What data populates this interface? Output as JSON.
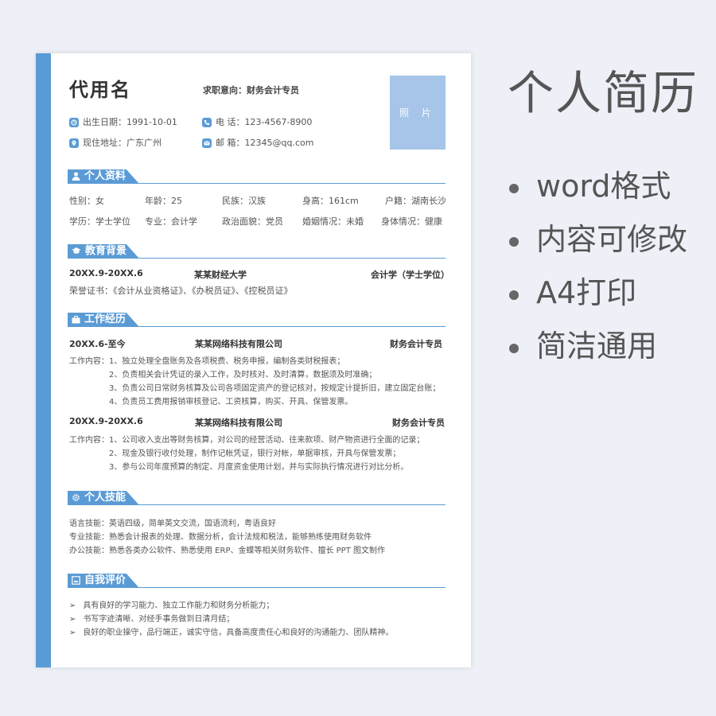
{
  "resume": {
    "name": "代用名",
    "intent": "求职意向：财务会计专员",
    "photo": "照 片",
    "birth": "出生日期：1991-10-01",
    "phone": "电  话：123-4567-8900",
    "address": "现住地址：广东广州",
    "email": "邮  箱：12345@qq.com",
    "sections": {
      "personal": "个人资料",
      "education": "教育背景",
      "work": "工作经历",
      "skills": "个人技能",
      "self": "自我评价"
    },
    "personal": {
      "row1": [
        "性别：女",
        "年龄：25",
        "民族：汉族",
        "身高：161cm",
        "户籍：湖南长沙"
      ],
      "row2": [
        "学历：学士学位",
        "专业：会计学",
        "政治面貌：党员",
        "婚姻情况：未婚",
        "身体情况：健康"
      ]
    },
    "education": {
      "period": "20XX.9-20XX.6",
      "school": "某某财经大学",
      "major": "会计学（学士学位）",
      "honors": "荣誉证书：《会计从业资格证》、《办税员证》、《控税员证》"
    },
    "work": [
      {
        "period": "20XX.6-至今",
        "company": "某某网络科技有限公司",
        "role": "财务会计专员",
        "lines": [
          "工作内容：1、独立处理全盘账务及各项税费、税务申报，编制各类财税报表；",
          "2、负责相关会计凭证的录入工作，及时核对、及时清算，数据须及时准确；",
          "3、负责公司日常财务核算及公司各项固定资产的登记核对，按规定计提折旧，建立固定台账；",
          "4、负责员工费用报销审核登记、工资核算，购买、开具、保管发票。"
        ]
      },
      {
        "period": "20XX.9-20XX.6",
        "company": "某某网络科技有限公司",
        "role": "财务会计专员",
        "lines": [
          "工作内容：1、公司收入支出等财务核算，对公司的经营活动、往来款项、财产物资进行全面的记录；",
          "2、现金及银行收付处理，制作记帐凭证，银行对帐，单据审核，开具与保管发票；",
          "3、参与公司年度预算的制定、月度资金使用计划，并与实际执行情况进行对比分析。"
        ]
      }
    ],
    "skills": [
      "语言技能：英语四级，简单英文交流，国语流利，粤语良好",
      "专业技能：熟悉会计报表的处理、数据分析，会计法规和税法，能够熟练使用财务软件",
      "办公技能：熟悉各类办公软件、熟悉使用 ERP、金蝶等相关财务软件、擅长 PPT 图文制作"
    ],
    "self": [
      "具有良好的学习能力、独立工作能力和财务分析能力；",
      "书写字迹清晰、对经手事务做到日清月结；",
      "良好的职业操守，品行端正，诚实守信，具备高度责任心和良好的沟通能力、团队精神。"
    ]
  },
  "promo": {
    "title": "个人简历",
    "features": [
      "word格式",
      "内容可修改",
      "A4打印",
      "简洁通用"
    ]
  },
  "colors": {
    "accent": "#5b9bd5",
    "photo": "#a6c5e9",
    "background": "#eef0f8"
  }
}
